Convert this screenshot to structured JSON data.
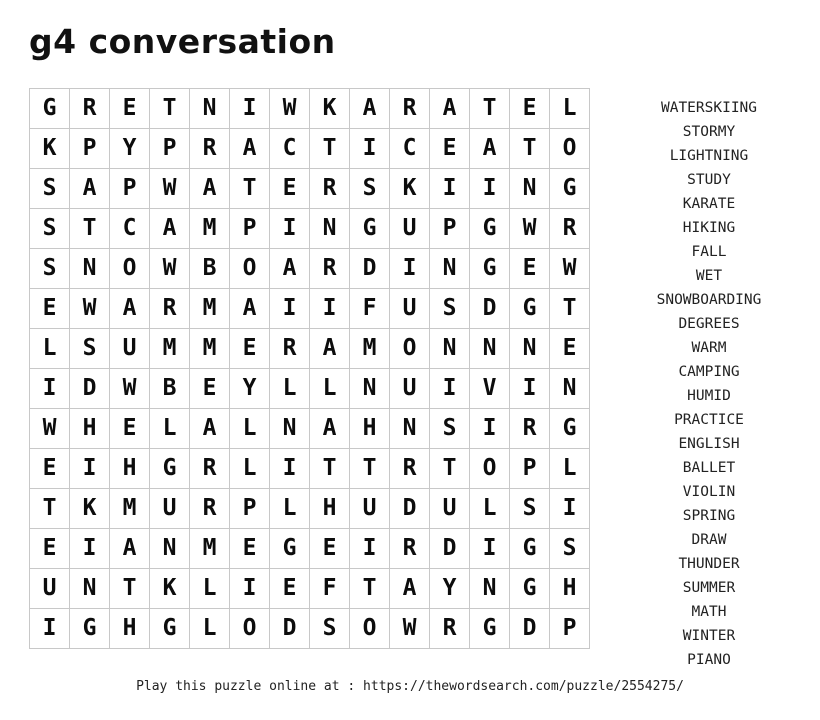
{
  "page": {
    "title": "g4 conversation",
    "footer": "Play this puzzle online at : https://thewordsearch.com/puzzle/2554275/"
  },
  "grid": {
    "columns": 14,
    "rows": 14,
    "border_color": "#c8c8c8",
    "letter_color": "#0c0c0c",
    "letters": [
      [
        "G",
        "R",
        "E",
        "T",
        "N",
        "I",
        "W",
        "K",
        "A",
        "R",
        "A",
        "T",
        "E",
        "L"
      ],
      [
        "K",
        "P",
        "Y",
        "P",
        "R",
        "A",
        "C",
        "T",
        "I",
        "C",
        "E",
        "A",
        "T",
        "O"
      ],
      [
        "S",
        "A",
        "P",
        "W",
        "A",
        "T",
        "E",
        "R",
        "S",
        "K",
        "I",
        "I",
        "N",
        "G"
      ],
      [
        "S",
        "T",
        "C",
        "A",
        "M",
        "P",
        "I",
        "N",
        "G",
        "U",
        "P",
        "G",
        "W",
        "R"
      ],
      [
        "S",
        "N",
        "O",
        "W",
        "B",
        "O",
        "A",
        "R",
        "D",
        "I",
        "N",
        "G",
        "E",
        "W"
      ],
      [
        "E",
        "W",
        "A",
        "R",
        "M",
        "A",
        "I",
        "I",
        "F",
        "U",
        "S",
        "D",
        "G",
        "T"
      ],
      [
        "L",
        "S",
        "U",
        "M",
        "M",
        "E",
        "R",
        "A",
        "M",
        "O",
        "N",
        "N",
        "N",
        "E"
      ],
      [
        "I",
        "D",
        "W",
        "B",
        "E",
        "Y",
        "L",
        "L",
        "N",
        "U",
        "I",
        "V",
        "I",
        "N"
      ],
      [
        "W",
        "H",
        "E",
        "L",
        "A",
        "L",
        "N",
        "A",
        "H",
        "N",
        "S",
        "I",
        "R",
        "G"
      ],
      [
        "E",
        "I",
        "H",
        "G",
        "R",
        "L",
        "I",
        "T",
        "T",
        "R",
        "T",
        "O",
        "P",
        "L"
      ],
      [
        "T",
        "K",
        "M",
        "U",
        "R",
        "P",
        "L",
        "H",
        "U",
        "D",
        "U",
        "L",
        "S",
        "I"
      ],
      [
        "E",
        "I",
        "A",
        "N",
        "M",
        "E",
        "G",
        "E",
        "I",
        "R",
        "D",
        "I",
        "G",
        "S"
      ],
      [
        "U",
        "N",
        "T",
        "K",
        "L",
        "I",
        "E",
        "F",
        "T",
        "A",
        "Y",
        "N",
        "G",
        "H"
      ],
      [
        "I",
        "G",
        "H",
        "G",
        "L",
        "O",
        "D",
        "S",
        "O",
        "W",
        "R",
        "G",
        "D",
        "P"
      ]
    ]
  },
  "word_list": {
    "words": [
      "WATERSKIING",
      "STORMY",
      "LIGHTNING",
      "STUDY",
      "KARATE",
      "HIKING",
      "FALL",
      "WET",
      "SNOWBOARDING",
      "DEGREES",
      "WARM",
      "CAMPING",
      "HUMID",
      "PRACTICE",
      "ENGLISH",
      "BALLET",
      "VIOLIN",
      "SPRING",
      "DRAW",
      "THUNDER",
      "SUMMER",
      "MATH",
      "WINTER",
      "PIANO"
    ]
  }
}
